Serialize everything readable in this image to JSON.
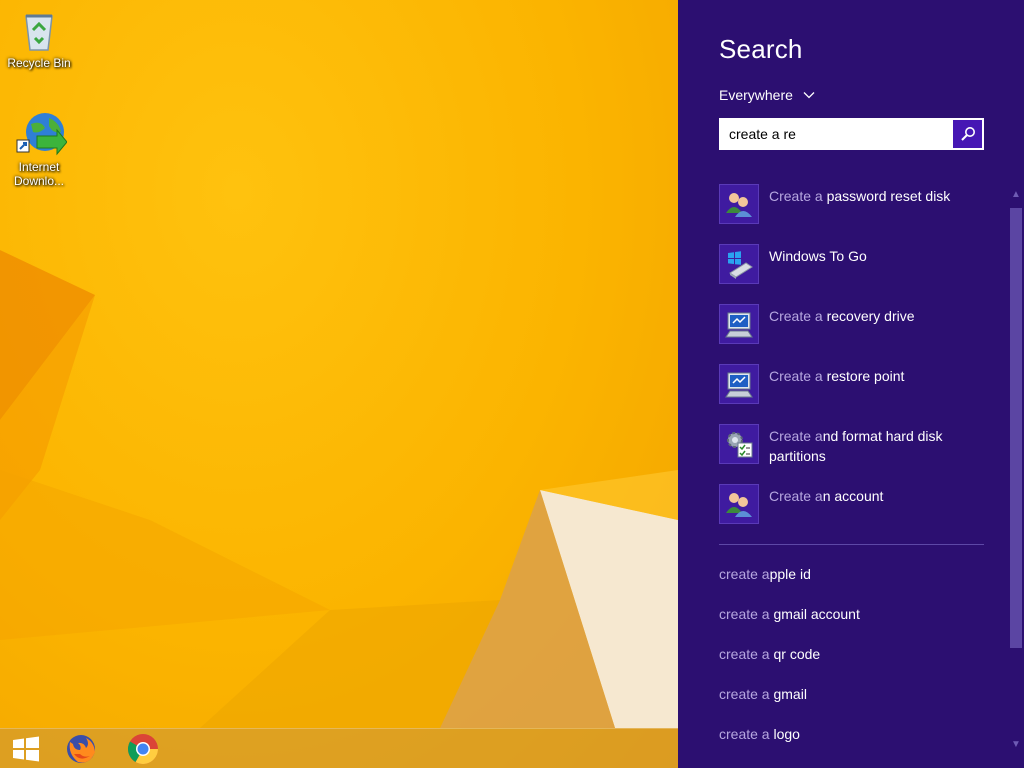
{
  "desktop": {
    "icons": [
      {
        "label": "Recycle Bin",
        "icon": "recycle-bin-icon"
      },
      {
        "label": "Internet\nDownlo...",
        "icon": "internet-download-manager-icon"
      }
    ]
  },
  "taskbar": {
    "items": [
      {
        "name": "start",
        "icon": "windows-logo-icon"
      },
      {
        "name": "firefox",
        "icon": "firefox-icon"
      },
      {
        "name": "chrome",
        "icon": "chrome-icon"
      }
    ]
  },
  "search": {
    "title": "Search",
    "scope": "Everywhere",
    "query": "create a re",
    "results": [
      {
        "prefix": "Create a",
        "rest": " password reset disk",
        "icon": "users-icon"
      },
      {
        "prefix": "",
        "rest": "Windows To Go",
        "icon": "usb-drive-icon"
      },
      {
        "prefix": "Create a",
        "rest": " recovery drive",
        "icon": "computer-monitor-icon"
      },
      {
        "prefix": "Create a",
        "rest": " restore point",
        "icon": "computer-monitor-icon"
      },
      {
        "prefix": "Create a",
        "rest": "nd format hard disk partitions",
        "icon": "disk-management-icon"
      },
      {
        "prefix": "Create a",
        "rest": "n account",
        "icon": "users-icon"
      }
    ],
    "suggestions": [
      {
        "prefix": "create a",
        "rest": "pple id"
      },
      {
        "prefix": "create a",
        "rest": " gmail account"
      },
      {
        "prefix": "create a",
        "rest": " qr code"
      },
      {
        "prefix": "create a",
        "rest": " gmail"
      },
      {
        "prefix": "create a",
        "rest": " logo"
      }
    ]
  },
  "colors": {
    "charm_background": "#2c0f71",
    "search_button": "#4617b4",
    "wallpaper": "#fbb400"
  }
}
